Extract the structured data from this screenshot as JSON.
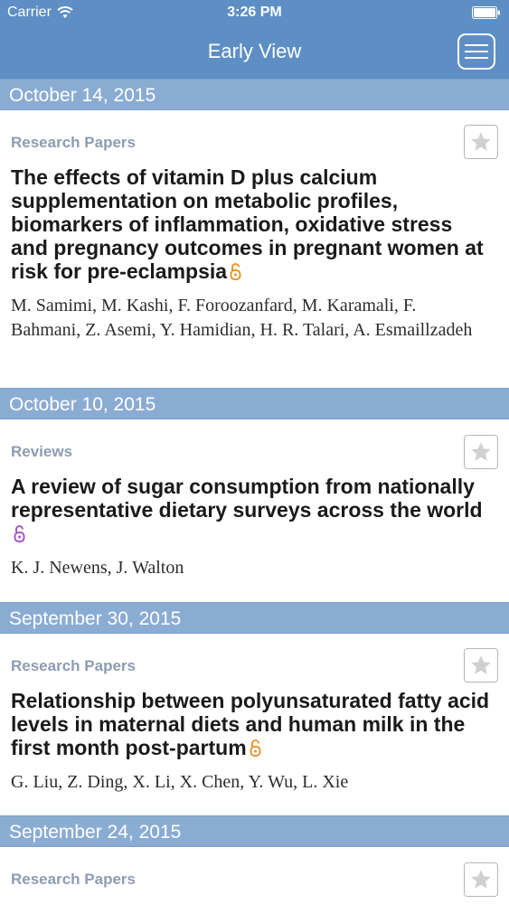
{
  "status_bar": {
    "carrier": "Carrier",
    "time": "3:26 PM"
  },
  "nav": {
    "title": "Early View"
  },
  "colors": {
    "header": "#5d8fc4",
    "date_bar": "#8aacd2",
    "lock_orange": "#e8962e",
    "lock_purple": "#a05ac0"
  },
  "sections": [
    {
      "date": "October 14, 2015",
      "category": "Research Papers",
      "title": "The effects of vitamin D plus calcium supplementation on metabolic profiles, biomarkers of inflammation, oxidative stress and pregnancy outcomes in pregnant women at risk for pre-eclampsia",
      "authors": "M. Samimi, M. Kashi, F. Foroozanfard, M. Karamali, F. Bahmani, Z. Asemi, Y. Hamidian, H. R. Talari, A. Esmaillzadeh",
      "lock_icon": "open-access-lock-icon"
    },
    {
      "date": "October 10, 2015",
      "category": "Reviews",
      "title": "A review of sugar consumption from nationally representative dietary surveys across the world",
      "authors": "K. J. Newens, J. Walton",
      "lock_icon": "open-access-lock-icon"
    },
    {
      "date": "September 30, 2015",
      "category": "Research Papers",
      "title": "Relationship between polyunsaturated fatty acid levels in maternal diets and human milk in the first month post-partum",
      "authors": "G. Liu, Z. Ding, X. Li, X. Chen, Y. Wu, L. Xie",
      "lock_icon": "open-access-lock-icon"
    },
    {
      "date": "September 24, 2015",
      "category": "Research Papers"
    }
  ]
}
